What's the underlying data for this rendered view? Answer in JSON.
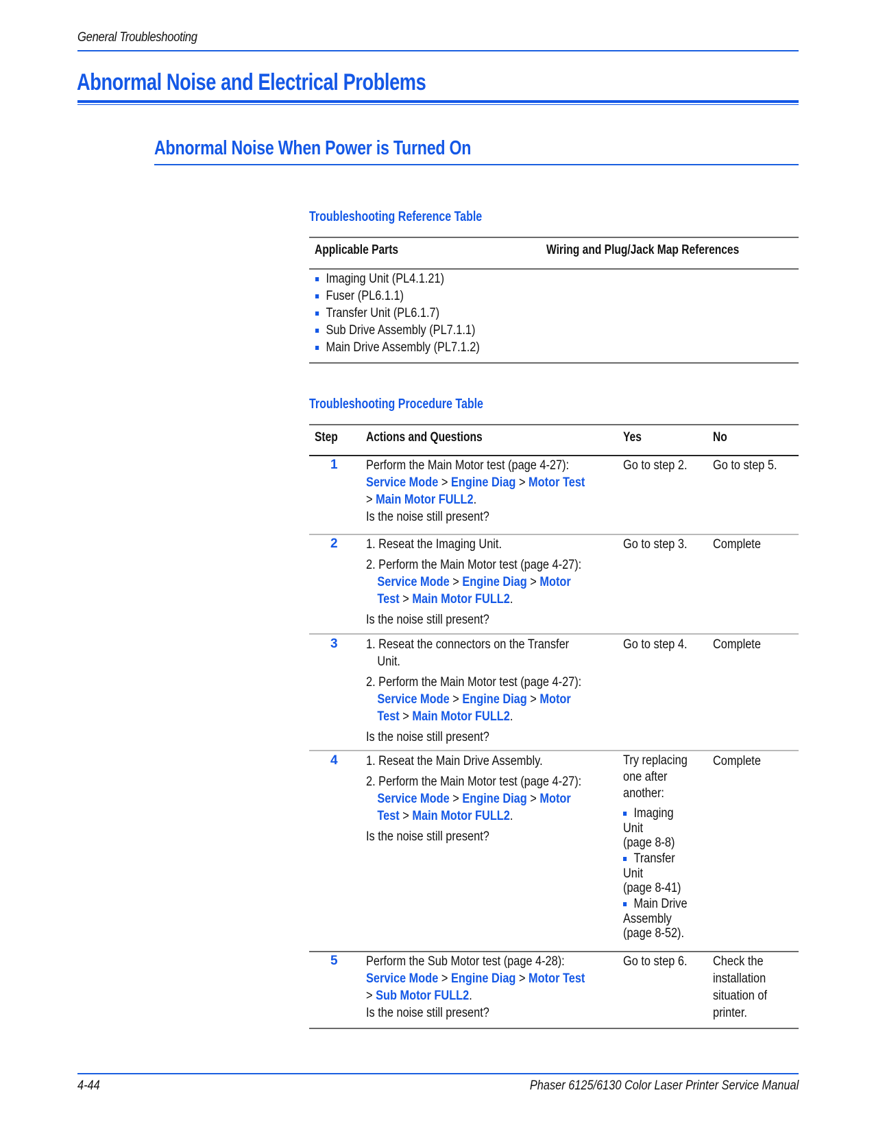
{
  "header": {
    "running_title": "General Troubleshooting"
  },
  "page_title": "Abnormal Noise and Electrical Problems",
  "section_title": "Abnormal Noise When Power is Turned On",
  "reference_table": {
    "caption": "Troubleshooting Reference Table",
    "columns": [
      "Applicable Parts",
      "Wiring and Plug/Jack Map References"
    ],
    "applicable_parts": [
      "Imaging Unit (PL4.1.21)",
      "Fuser (PL6.1.1)",
      "Transfer Unit (PL6.1.7)",
      "Sub Drive Assembly (PL7.1.1)",
      "Main Drive Assembly (PL7.1.2)"
    ],
    "wiring_references": []
  },
  "procedure_table": {
    "caption": "Troubleshooting Procedure Table",
    "columns": [
      "Step",
      "Actions and Questions",
      "Yes",
      "No"
    ],
    "menu": {
      "service_mode": "Service Mode",
      "engine_diag": "Engine Diag",
      "motor_test": "Motor Test",
      "motor": "Motor",
      "test": "Test",
      "main_motor_full2": "Main Motor FULL2",
      "sub_motor_full2": "Sub Motor FULL2",
      "sep": ">",
      "period": "."
    },
    "steps": [
      {
        "step": "1",
        "action_intro": "Perform the Main Motor test (page 4-27):",
        "question": "Is the noise still present?",
        "yes": "Go to step 2.",
        "no": "Go to step 5."
      },
      {
        "step": "2",
        "action_1": "1. Reseat the Imaging Unit.",
        "action_2": "2. Perform the Main Motor test (page 4-27):",
        "question": "Is the noise still present?",
        "yes": "Go to step 3.",
        "no": "Complete"
      },
      {
        "step": "3",
        "action_1a": "1. Reseat the connectors on the Transfer",
        "action_1b": "Unit.",
        "action_2": "2. Perform the Main Motor test (page 4-27):",
        "question": "Is the noise still present?",
        "yes": "Go to step 4.",
        "no": "Complete"
      },
      {
        "step": "4",
        "action_1": "1. Reseat the Main Drive Assembly.",
        "action_2": "2. Perform the Main Motor test (page 4-27):",
        "question": "Is the noise still present?",
        "yes_intro": [
          "Try replacing",
          "one after",
          "another:"
        ],
        "yes_items": [
          [
            "Imaging",
            "Unit",
            "(page 8-8)"
          ],
          [
            "Transfer",
            "Unit",
            "(page 8-41)"
          ],
          [
            "Main Drive",
            "Assembly",
            "(page 8-52)."
          ]
        ],
        "no": "Complete"
      },
      {
        "step": "5",
        "action_intro": "Perform the Sub Motor test (page 4-28):",
        "question": "Is the noise still present?",
        "yes": "Go to step 6.",
        "no": [
          "Check the",
          "installation",
          "situation of",
          "printer."
        ]
      }
    ]
  },
  "footer": {
    "page_number": "4-44",
    "manual_title": "Phaser 6125/6130 Color Laser Printer Service Manual"
  },
  "colors": {
    "accent_blue": "#1458e6",
    "text": "#111111"
  }
}
